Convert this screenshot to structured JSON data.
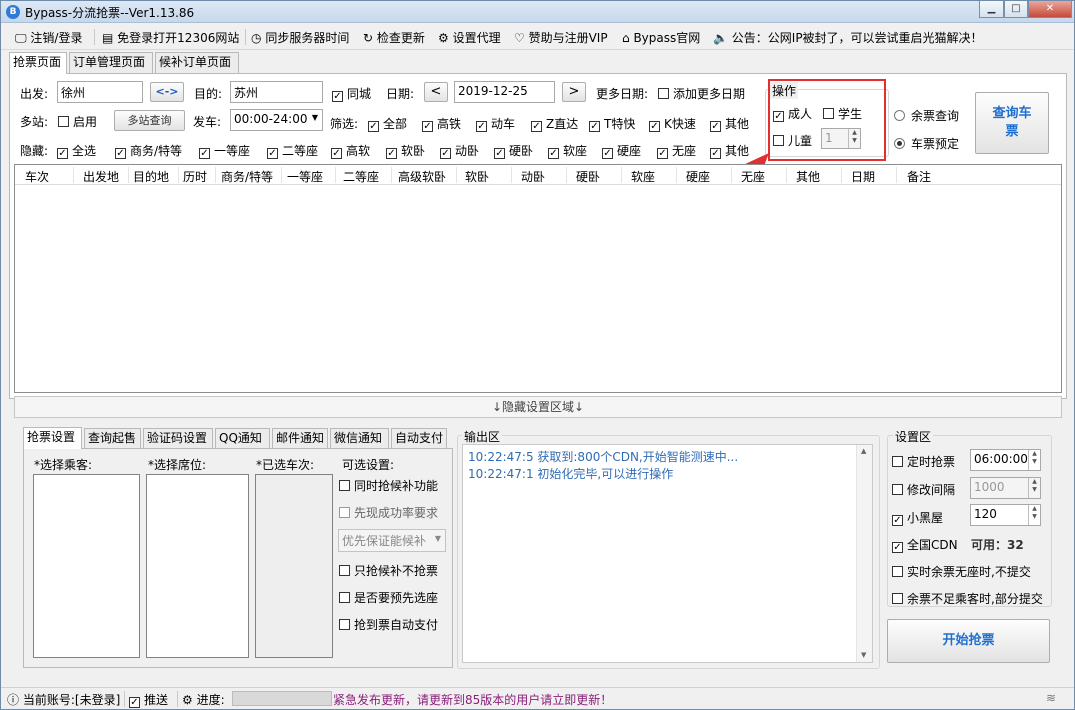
{
  "window": {
    "title": "Bypass-分流抢票--Ver1.13.86",
    "icon": "ticket-app-icon"
  },
  "toolbar": {
    "items": [
      {
        "label": "注销/登录",
        "icon": "monitor-icon"
      },
      {
        "label": "免登录打开12306网站",
        "icon": "clipboard-icon"
      },
      {
        "label": "同步服务器时间",
        "icon": "clock-icon"
      },
      {
        "label": "检查更新",
        "icon": "refresh-icon"
      },
      {
        "label": "设置代理",
        "icon": "gear-icon"
      },
      {
        "label": "赞助与注册VIP",
        "icon": "heart-icon"
      },
      {
        "label": "Bypass官网",
        "icon": "home-icon"
      },
      {
        "label": "公告：公网IP被封了，可以尝试重启光猫解决！",
        "icon": "speaker-icon"
      }
    ]
  },
  "tabs": [
    "抢票页面",
    "订单管理页面",
    "候补订单页面"
  ],
  "search": {
    "from_label": "出发:",
    "from_value": "徐州",
    "swap_label": "<->",
    "to_label": "目的:",
    "to_value": "苏州",
    "same_city_label": "同城",
    "date_label": "日期:",
    "date_value": "2019-12-25",
    "prev_label": "<",
    "next_label": ">",
    "more_dates_label": "更多日期:",
    "add_dates_label": "添加更多日期",
    "multi_label": "多站:",
    "enable_label": "启用",
    "multi_query_label": "多站查询",
    "depart_label": "发车:",
    "depart_value": "00:00-24:00",
    "filter_label": "筛选:",
    "filters": [
      "全部",
      "高铁",
      "动车",
      "Z直达",
      "T特快",
      "K快速",
      "其他"
    ],
    "hide_label": "隐藏:",
    "hides": [
      "全选",
      "商务/特等",
      "一等座",
      "二等座",
      "高软",
      "软卧",
      "动卧",
      "硬卧",
      "软座",
      "硬座",
      "无座",
      "其他"
    ]
  },
  "operate": {
    "title": "操作",
    "adult": "成人",
    "student": "学生",
    "child": "儿童",
    "child_count": "1",
    "remain_query": "余票查询",
    "reserve": "车票预定",
    "query_button": "查询车票"
  },
  "grid": {
    "columns": [
      "车次",
      "出发地",
      "目的地",
      "历时",
      "商务/特等",
      "一等座",
      "二等座",
      "高级软卧",
      "软卧",
      "动卧",
      "硬卧",
      "软座",
      "硬座",
      "无座",
      "其他",
      "日期",
      "备注"
    ]
  },
  "hidden_area_label": "↓隐藏设置区域↓",
  "bottom_tabs": [
    "抢票设置",
    "查询起售",
    "验证码设置",
    "QQ通知",
    "邮件通知",
    "微信通知",
    "自动支付"
  ],
  "ticket_settings": {
    "passenger_label": "*选择乘客:",
    "seat_label": "*选择席位:",
    "trains_label": "*已选车次:",
    "optional_label": "可选设置:",
    "opts": [
      "同时抢候补功能",
      "先现成功率要求"
    ],
    "priority_value": "优先保证能候补",
    "opts2": [
      "只抢候补不抢票",
      "是否要预先选座",
      "抢到票自动支付"
    ]
  },
  "output": {
    "title": "输出区",
    "lines": [
      "10:22:47:5  获取到:800个CDN,开始智能测速中...",
      "10:22:47:1  初始化完毕,可以进行操作"
    ]
  },
  "settings": {
    "title": "设置区",
    "timed_label": "定时抢票",
    "timed_value": "06:00:00",
    "interval_label": "修改间隔",
    "interval_value": "1000",
    "blackroom_label": "小黑屋",
    "blackroom_value": "120",
    "cdn_label": "全国CDN",
    "cdn_avail": "可用：32",
    "realtime_label": "实时余票无座时,不提交",
    "partial_label": "余票不足乘客时,部分提交",
    "start_button": "开始抢票"
  },
  "status": {
    "account_label": "当前账号:[未登录]",
    "push_label": "推送",
    "progress_label": "进度:",
    "notice": "紧急发布更新，请更新到85版本的用户请立即更新！"
  }
}
